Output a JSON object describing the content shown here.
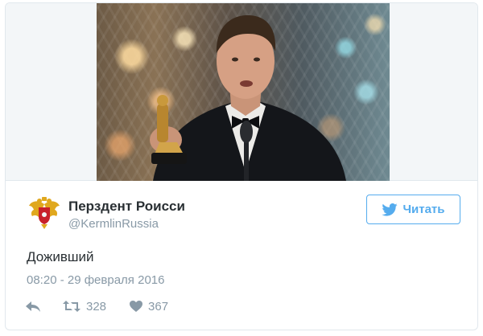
{
  "tweet": {
    "media": {
      "description_icon": "photo-image"
    },
    "author": {
      "display_name": "Перздент Роисси",
      "handle": "@KermlinRussia",
      "avatar_icon": "coat-of-arms-icon"
    },
    "follow_button": {
      "label": "Читать",
      "icon": "twitter-bird-icon"
    },
    "text": "Доживший",
    "timestamp": "08:20 - 29 февраля 2016",
    "actions": {
      "reply_icon": "reply-icon",
      "retweet_icon": "retweet-icon",
      "retweet_count": "328",
      "like_icon": "heart-icon",
      "like_count": "367"
    }
  },
  "colors": {
    "accent": "#55acee",
    "text_primary": "#292f33",
    "text_secondary": "#8899a6",
    "border": "#e1e8ed"
  }
}
